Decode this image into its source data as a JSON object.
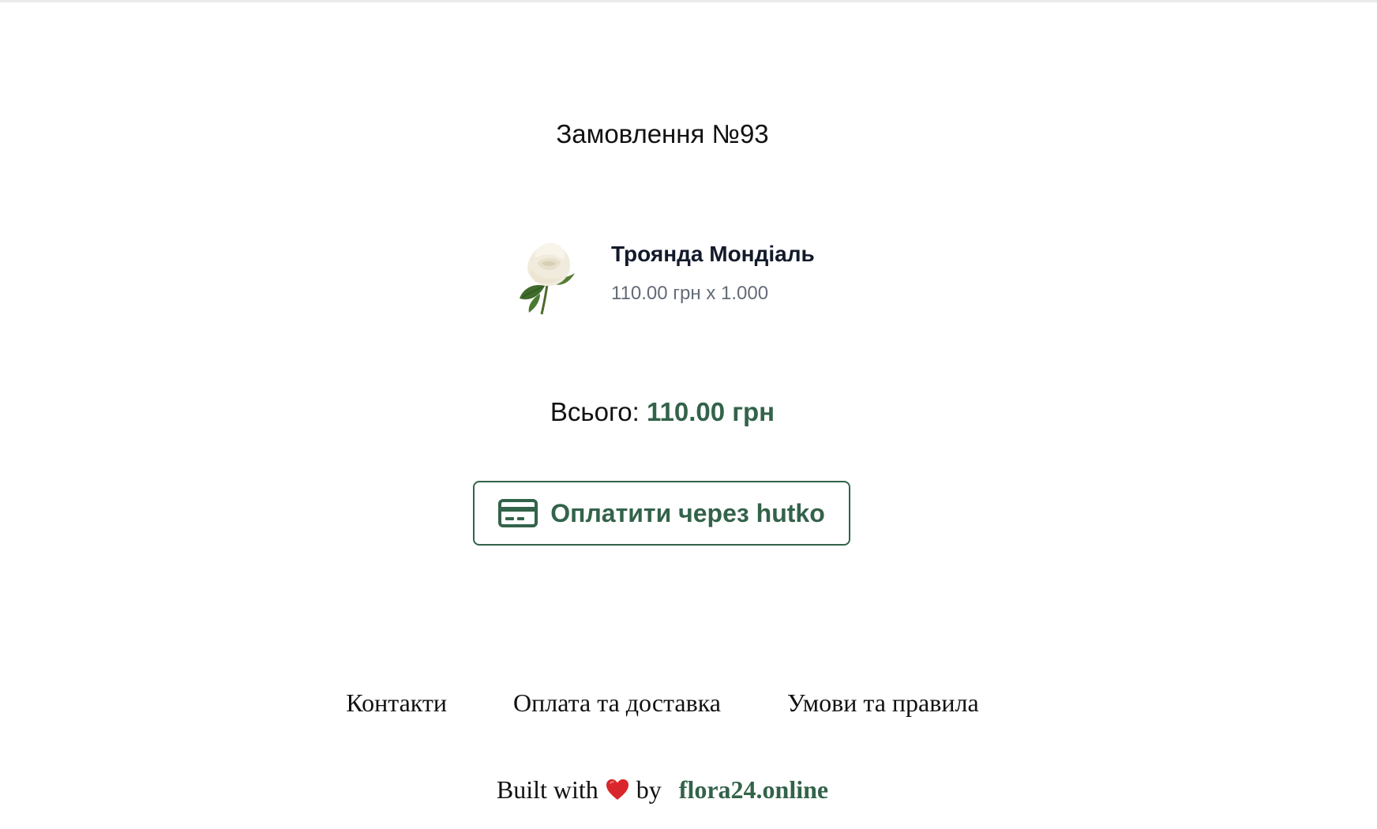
{
  "order": {
    "title": "Замовлення №93"
  },
  "items": [
    {
      "name": "Троянда Мондіаль",
      "price_line": "110.00 грн x 1.000",
      "image_icon": "white-rose-icon"
    }
  ],
  "total": {
    "label": "Всього:",
    "amount": "110.00 грн"
  },
  "payment": {
    "button_label": "Оплатити через hutko",
    "icon": "credit-card-icon"
  },
  "footer": {
    "links": [
      "Контакти",
      "Оплата та доставка",
      "Умови та правила"
    ],
    "built_prefix": "Built with",
    "built_icon": "heart-icon",
    "built_by": "by",
    "brand": "flora24.online"
  },
  "colors": {
    "accent": "#33634a",
    "text": "#111111",
    "muted": "#646b78",
    "heart": "#d9262c"
  }
}
